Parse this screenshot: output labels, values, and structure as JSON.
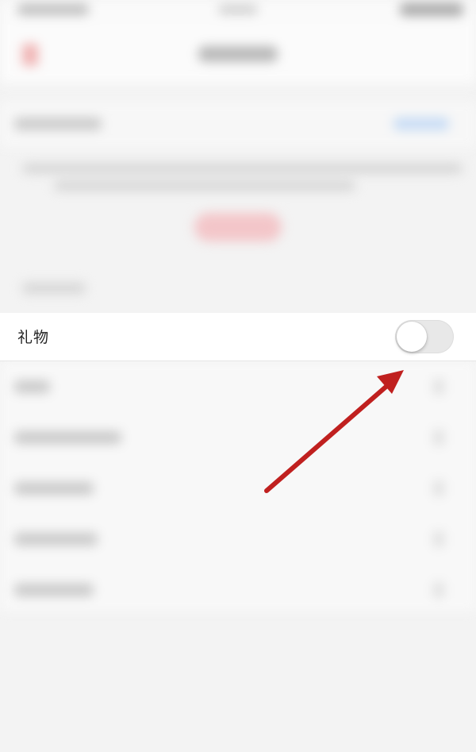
{
  "setting_row": {
    "label": "礼物",
    "toggle_state": "off"
  },
  "annotation": {
    "type": "arrow",
    "color": "#c0201f",
    "points_to": "gift-toggle"
  }
}
